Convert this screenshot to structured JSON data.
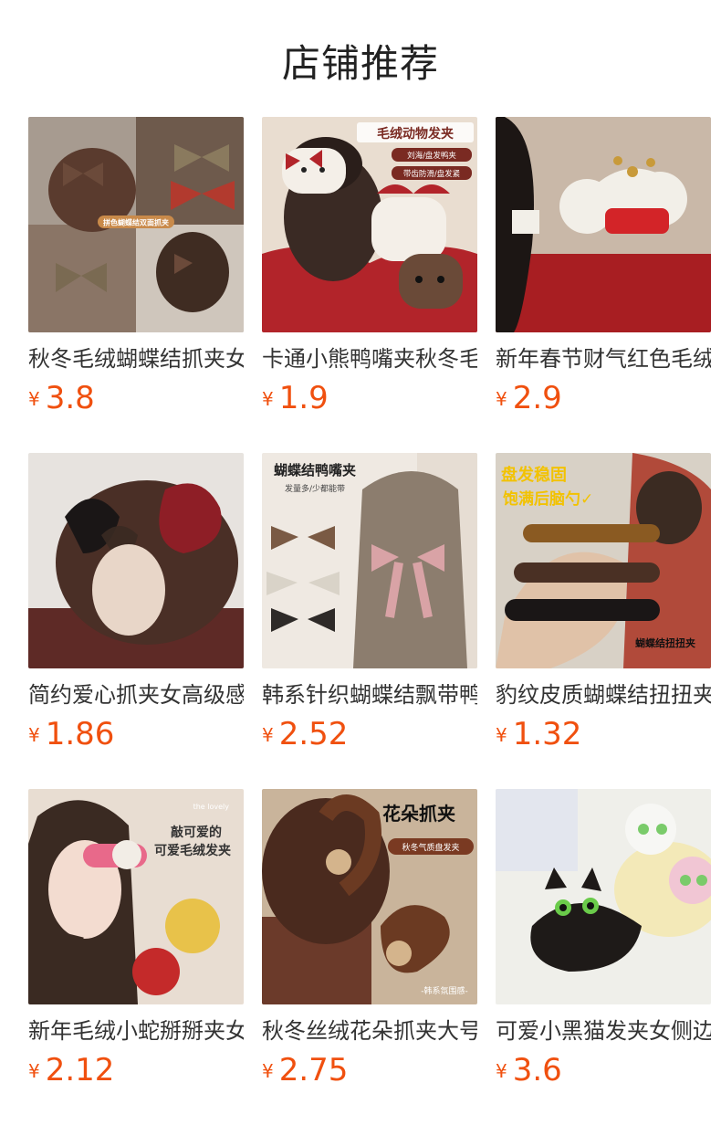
{
  "page": {
    "title": "店铺推荐"
  },
  "currency": "¥",
  "products": [
    {
      "name": "秋冬毛绒蝴蝶结抓夹女",
      "price": "3.8",
      "image_text": [
        "拼色蝴蝶结双面抓夹"
      ],
      "palette": [
        "#b8b0a6",
        "#5a3b2e",
        "#b23a2e"
      ]
    },
    {
      "name": "卡通小熊鸭嘴夹秋冬毛绒",
      "price": "1.9",
      "image_text": [
        "毛绒动物发夹",
        "刘海/盘发鸭夹",
        "带齿防滑/盘发紧"
      ],
      "palette": [
        "#e9ddd0",
        "#3a2a24",
        "#b2242a"
      ]
    },
    {
      "name": "新年春节财气红色毛绒",
      "price": "2.9",
      "image_text": [],
      "palette": [
        "#c9b8a8",
        "#c31e22",
        "#f2efe8"
      ]
    },
    {
      "name": "简约爱心抓夹女高级感",
      "price": "1.86",
      "image_text": [],
      "palette": [
        "#e7e3df",
        "#4a2f26",
        "#8e1e26"
      ]
    },
    {
      "name": "韩系针织蝴蝶结飘带鸭嘴夹",
      "price": "2.52",
      "image_text": [
        "蝴蝶结鸭嘴夹",
        "发量多/少都能带"
      ],
      "palette": [
        "#efe9e2",
        "#8c7d6e",
        "#d9a3a6"
      ]
    },
    {
      "name": "豹纹皮质蝴蝶结扭扭夹",
      "price": "1.32",
      "image_text": [
        "盘发稳固",
        "饱满后脑勺✓",
        "蝴蝶结扭扭夹"
      ],
      "palette": [
        "#d8d1c6",
        "#3b2b22",
        "#f2c200"
      ]
    },
    {
      "name": "新年毛绒小蛇掰掰夹女",
      "price": "2.12",
      "image_text": [
        "the lovely",
        "敲可爱的",
        "可爱毛绒发夹"
      ],
      "palette": [
        "#e8ddd2",
        "#3a2a22",
        "#e8698a"
      ]
    },
    {
      "name": "秋冬丝绒花朵抓夹大号",
      "price": "2.75",
      "image_text": [
        "花朵抓夹",
        "秋冬气质盘发夹",
        "-韩系氛围感-"
      ],
      "palette": [
        "#c9b49b",
        "#4a2a1e",
        "#6b3a22"
      ]
    },
    {
      "name": "可爱小黑猫发夹女侧边",
      "price": "3.6",
      "image_text": [],
      "palette": [
        "#efefea",
        "#1e1a18",
        "#f1c6d4"
      ]
    }
  ]
}
